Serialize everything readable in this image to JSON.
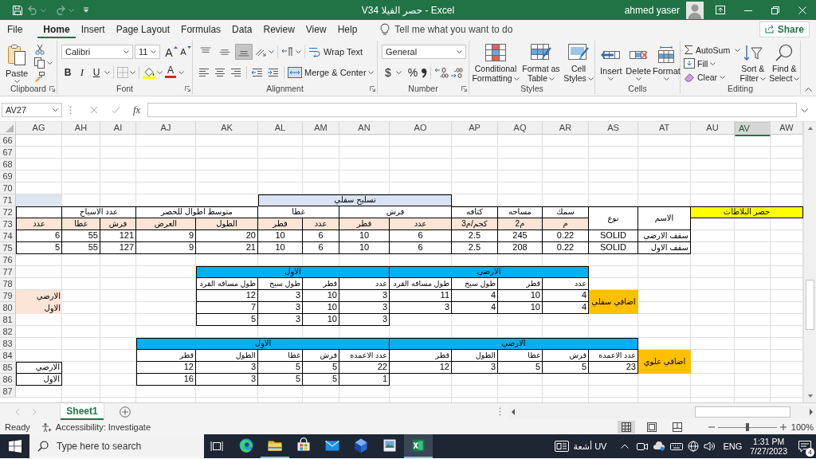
{
  "window": {
    "title": "V34 حصر الفيلا - Excel",
    "user": "ahmed yaser"
  },
  "quick_access": [
    {
      "kind": "save",
      "disabled": false
    },
    {
      "kind": "undo",
      "disabled": true
    },
    {
      "kind": "redo",
      "disabled": true
    }
  ],
  "menu_tabs": [
    {
      "label": "Help",
      "selected": false
    },
    {
      "label": "View",
      "selected": false
    },
    {
      "label": "Review",
      "selected": false
    },
    {
      "label": "Data",
      "selected": false
    },
    {
      "label": "Formulas",
      "selected": false
    },
    {
      "label": "Page Layout",
      "selected": false
    },
    {
      "label": "Insert",
      "selected": false
    },
    {
      "label": "Home",
      "selected": true
    },
    {
      "label": "File",
      "selected": false
    }
  ],
  "tell_me": {
    "placeholder": "Tell me what you want to do"
  },
  "share_button": "Share",
  "ribbon": {
    "clipboard": {
      "paste": "Paste",
      "label": "Clipboard"
    },
    "font": {
      "font_name": "Calibri",
      "font_size": "11",
      "grow": "A",
      "shrink": "A",
      "bold": "B",
      "italic": "I",
      "underline": "U",
      "font_color": "A",
      "label": "Font"
    },
    "alignment": {
      "vertical_align": [
        {
          "kind": "top",
          "selected": false
        },
        {
          "kind": "middle",
          "selected": false
        },
        {
          "kind": "bottom",
          "selected": true
        }
      ],
      "wrap_text": "Wrap Text",
      "merge": "Merge & Center",
      "label": "Alignment"
    },
    "number": {
      "format": "General",
      "currency": "$",
      "percent": "%",
      "label": "Number"
    },
    "styles": {
      "buttons": [
        "Cell Styles",
        "Format as Table",
        "Conditional Formatting"
      ],
      "label": "Styles"
    },
    "cells": {
      "buttons": [
        "Format",
        "Delete",
        "Insert"
      ],
      "label": "Cells"
    },
    "editing": {
      "autosum": "AutoSum",
      "fill": "Fill",
      "clear": "Clear",
      "sort_filter": "Sort & Filter",
      "find_select": "Find & Select",
      "label": "Editing"
    }
  },
  "formula_bar": {
    "name_box": "AV27",
    "function_button": "fx"
  },
  "sheet": {
    "columns": [
      {
        "label": "AW",
        "selected": false
      },
      {
        "label": "AV",
        "selected": true
      },
      {
        "label": "AU",
        "selected": false
      },
      {
        "label": "AT",
        "selected": false
      },
      {
        "label": "AS",
        "selected": false
      },
      {
        "label": "AR",
        "selected": false
      },
      {
        "label": "AQ",
        "selected": false
      },
      {
        "label": "AP",
        "selected": false
      },
      {
        "label": "AO",
        "selected": false
      },
      {
        "label": "AN",
        "selected": false
      },
      {
        "label": "AM",
        "selected": false
      },
      {
        "label": "AL",
        "selected": false
      },
      {
        "label": "AK",
        "selected": false
      },
      {
        "label": "AJ",
        "selected": false
      },
      {
        "label": "AI",
        "selected": false
      },
      {
        "label": "AH",
        "selected": false
      },
      {
        "label": "AG",
        "selected": false
      }
    ],
    "rows": [
      "66",
      "67",
      "68",
      "69",
      "70",
      "71",
      "72",
      "73",
      "74",
      "75",
      "76",
      "77",
      "78",
      "79",
      "80",
      "81",
      "82",
      "83",
      "84",
      "85",
      "86",
      "87"
    ],
    "slab_table": {
      "title": "حصر البلاطات",
      "group_title": "تسليح سفلي",
      "headers": [
        "الاسم",
        "نوع",
        "سمك",
        "مساحه",
        "كثافه",
        "فرش",
        "غطا",
        "متوسط اطوال للحصر",
        "عدد الاسياخ"
      ],
      "subheaders": [
        "م",
        "م2",
        "كجم/م3",
        "عدد",
        "قطر",
        "عدد",
        "قطر",
        "الطول",
        "العرض",
        "فرش",
        "غطا",
        "عدد"
      ],
      "rows": [
        [
          "سقف الارضي",
          "SOLID",
          "0.22",
          "245",
          "2.5",
          "6",
          "10",
          "6",
          "10",
          "20",
          "9",
          "121",
          "55",
          "6"
        ],
        [
          "سقف الاول",
          "SOLID",
          "0.22",
          "208",
          "2.5",
          "6",
          "10",
          "6",
          "10",
          "21",
          "9",
          "127",
          "55",
          "5"
        ]
      ]
    },
    "bottom_extra": {
      "label": "اضاقي سفلي",
      "groups": [
        {
          "title": "الارضي",
          "headers": [
            "عدد",
            "قطر",
            "طول سيخ",
            "طول مسافه القرد"
          ],
          "rows": [
            [
              "4",
              "10",
              "4",
              "11"
            ],
            [
              "4",
              "10",
              "4",
              "3"
            ]
          ]
        },
        {
          "title": "الاول",
          "headers": [
            "عدد",
            "قطر",
            "طول سيخ",
            "طول مسافه القرد"
          ],
          "rows": [
            [
              "3",
              "10",
              "3",
              "12"
            ],
            [
              "3",
              "10",
              "3",
              "7"
            ],
            [
              "3",
              "10",
              "3",
              "5"
            ]
          ]
        }
      ],
      "side_labels": [
        "الارضي",
        "الاول"
      ]
    },
    "top_extra": {
      "label": "اضاقي علوي",
      "groups": [
        {
          "title": "الارضي",
          "headers": [
            "عدد الاعمده",
            "فرش",
            "غطا",
            "الطول",
            "قطر"
          ],
          "rows": [
            [
              "23",
              "5",
              "5",
              "3",
              "12"
            ]
          ]
        },
        {
          "title": "الاول",
          "headers": [
            "عدد الاعمده",
            "فرش",
            "غطا",
            "الطول",
            "قطر"
          ],
          "rows": [
            [
              "22",
              "5",
              "5",
              "3",
              "12"
            ],
            [
              "1",
              "5",
              "5",
              "3",
              "16"
            ]
          ]
        }
      ],
      "side_labels": [
        "الارضي",
        "الاول"
      ]
    }
  },
  "sheet_tabs": [
    {
      "label": "Sheet1",
      "selected": true
    }
  ],
  "status_bar": {
    "status": "Ready",
    "accessibility": "Accessibility: Investigate",
    "views": [
      {
        "kind": "normal",
        "selected": true
      },
      {
        "kind": "page_layout",
        "selected": false
      },
      {
        "kind": "page_break",
        "selected": false
      }
    ],
    "zoom": {
      "level": 0.5,
      "reading": "100%"
    }
  },
  "taskbar": {
    "search": {
      "placeholder": "Type here to search"
    },
    "apps": [
      {
        "kind": "browser",
        "selected": false,
        "running": false
      },
      {
        "kind": "folder",
        "selected": false,
        "running": true
      },
      {
        "kind": "store",
        "selected": false,
        "running": false
      },
      {
        "kind": "mail",
        "selected": false,
        "running": false
      },
      {
        "kind": "cube",
        "selected": false,
        "running": false
      },
      {
        "kind": "photos",
        "selected": false,
        "running": false
      },
      {
        "kind": "spreadsheet",
        "selected": true,
        "running": true
      }
    ],
    "weather": "أشعة UV",
    "language": "ENG",
    "time": "1:31 PM",
    "date": "7/27/2023",
    "notifications": "4"
  }
}
